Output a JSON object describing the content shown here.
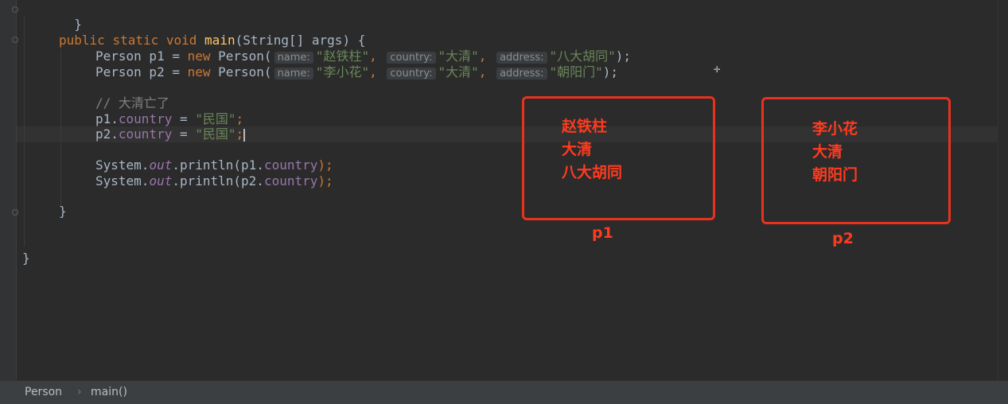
{
  "editor": {
    "line_close_brace_1": "}",
    "main_signature": {
      "kw_public": "public",
      "kw_static": "static",
      "kw_void": "void",
      "name": "main",
      "params": "(String[] args) {"
    },
    "p1_decl": {
      "type_var": "Person p1 = ",
      "kw_new": "new",
      "ctor": " Person(",
      "hint_name": "name:",
      "arg_name": "\"赵铁柱\"",
      "hint_country": "country:",
      "arg_country": "\"大清\"",
      "hint_address": "address:",
      "arg_address": "\"八大胡同\"",
      "end": ");"
    },
    "p2_decl": {
      "type_var": "Person p2 = ",
      "kw_new": "new",
      "ctor": " Person(",
      "hint_name": "name:",
      "arg_name": "\"李小花\"",
      "hint_country": "country:",
      "arg_country": "\"大清\"",
      "hint_address": "address:",
      "arg_address": "\"朝阳门\"",
      "end": ");"
    },
    "comment": "// 大清亡了",
    "assign_p1": {
      "obj": "p1.",
      "field": "country",
      "op": " = ",
      "value": "\"民国\"",
      "end": ";"
    },
    "assign_p2": {
      "obj": "p2.",
      "field": "country",
      "op": " = ",
      "value": "\"民国\"",
      "end": ";"
    },
    "print_p1": {
      "prefix": "System.",
      "static": "out",
      "call": ".println(p1.",
      "field": "country",
      "end": ");"
    },
    "print_p2": {
      "prefix": "System.",
      "static": "out",
      "call": ".println(p2.",
      "field": "country",
      "end": ");"
    },
    "line_close_brace_main": "}",
    "line_close_brace_class": "}"
  },
  "annotations": {
    "accent_color": "#e8321e",
    "p1_box": {
      "lines": [
        "赵铁柱",
        "大清",
        "八大胡同"
      ],
      "label": "p1"
    },
    "p2_box": {
      "lines": [
        "李小花",
        "大清",
        "朝阳门"
      ],
      "label": "p2"
    }
  },
  "statusbar": {
    "breadcrumb": [
      "Person",
      "main()"
    ],
    "separator_icon": "chevron-right-icon"
  }
}
